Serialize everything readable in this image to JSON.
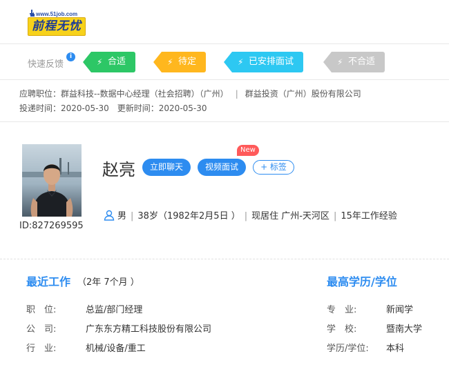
{
  "header": {
    "logo_url": "www.51job.com",
    "logo_text": "前程无忧"
  },
  "feedback": {
    "label": "快速反馈",
    "info_icon": "i",
    "buttons": [
      {
        "label": "合适",
        "color": "#2dc766"
      },
      {
        "label": "待定",
        "color": "#ffb71e"
      },
      {
        "label": "已安排面试",
        "color": "#2dc8f2"
      },
      {
        "label": "不合适",
        "color": "#c8c8c8"
      }
    ]
  },
  "job": {
    "position_label": "应聘职位：",
    "position": "群益科技--数据中心经理（社会招聘）（广州）",
    "company": "群益投资（广州）股份有限公司",
    "apply_time_label": "投递时间：",
    "apply_time": "2020-05-30",
    "update_time_label": "更新时间：",
    "update_time": "2020-05-30"
  },
  "profile": {
    "name": "赵亮",
    "id_text": "ID:827269595",
    "chat_button": "立即聊天",
    "video_button": "视频面试",
    "new_badge": "New",
    "tag_button": "+ 标签",
    "gender": "男",
    "age": "38岁（1982年2月5日 ）",
    "residence": "现居住 广州-天河区",
    "experience": "15年工作经验"
  },
  "recent_work": {
    "title": "最近工作",
    "duration": "（2年 7个月 ）",
    "position_label": "职　位:",
    "position": "总监/部门经理",
    "company_label": "公　司:",
    "company": "广东东方精工科技股份有限公司",
    "industry_label": "行　业:",
    "industry": "机械/设备/重工"
  },
  "education": {
    "title": "最高学历/学位",
    "major_label": "专　业:",
    "major": "新闻学",
    "school_label": "学　校:",
    "school": "暨南大学",
    "degree_label": "学历/学位:",
    "degree": "本科"
  },
  "colors": {
    "accent": "#2d8cf0",
    "new_badge": "#ff5a5a"
  }
}
